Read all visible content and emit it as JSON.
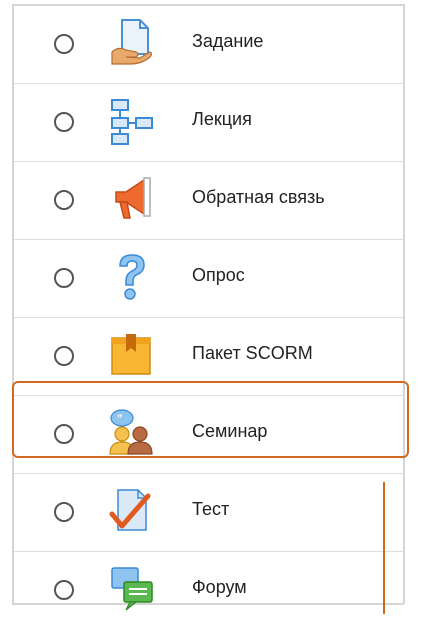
{
  "activities": [
    {
      "label": "Задание",
      "icon": "assignment-icon"
    },
    {
      "label": "Лекция",
      "icon": "lesson-icon"
    },
    {
      "label": "Обратная связь",
      "icon": "feedback-icon"
    },
    {
      "label": "Опрос",
      "icon": "choice-icon"
    },
    {
      "label": "Пакет SCORM",
      "icon": "scorm-icon"
    },
    {
      "label": "Семинар",
      "icon": "workshop-icon"
    },
    {
      "label": "Тест",
      "icon": "quiz-icon"
    },
    {
      "label": "Форум",
      "icon": "forum-icon"
    }
  ],
  "highlighted": "Семинар",
  "colors": {
    "highlight": "#d2691e"
  }
}
